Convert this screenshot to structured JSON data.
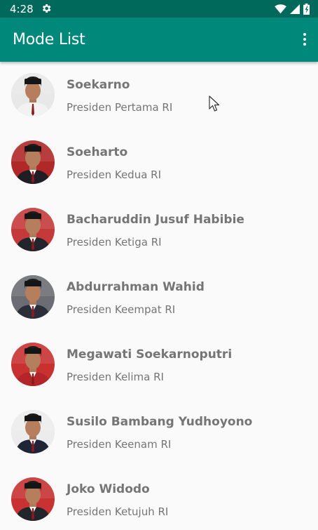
{
  "status_bar": {
    "time": "4:28",
    "icons": [
      "settings-gear-icon",
      "wifi-icon",
      "cellular-signal-icon",
      "battery-icon"
    ]
  },
  "app_bar": {
    "title": "Mode List",
    "overflow_icon": "more-vert-icon"
  },
  "colors": {
    "status_bar": "#00695c",
    "app_bar": "#00897b",
    "text_secondary": "#757575",
    "background": "#fafafa"
  },
  "presidents": [
    {
      "name": "Soekarno",
      "title": "Presiden Pertama RI",
      "photo_bg": "#e8e8e8",
      "suit": "#f2f2f2"
    },
    {
      "name": "Soeharto",
      "title": "Presiden Kedua RI",
      "photo_bg": "#b02828",
      "suit": "#1e1e24"
    },
    {
      "name": "Bacharuddin Jusuf Habibie",
      "title": "Presiden Ketiga RI",
      "photo_bg": "#c43a3a",
      "suit": "#22252b"
    },
    {
      "name": "Abdurrahman Wahid",
      "title": "Presiden Keempat RI",
      "photo_bg": "#6c6c74",
      "suit": "#2a2e3a"
    },
    {
      "name": "Megawati Soekarnoputri",
      "title": "Presiden Kelima RI",
      "photo_bg": "#c93030",
      "suit": "#b2262a"
    },
    {
      "name": "Susilo Bambang Yudhoyono",
      "title": "Presiden Keenam RI",
      "photo_bg": "#ececec",
      "suit": "#1f2436"
    },
    {
      "name": "Joko Widodo",
      "title": "Presiden Ketujuh RI",
      "photo_bg": "#c83232",
      "suit": "#23252c"
    }
  ]
}
